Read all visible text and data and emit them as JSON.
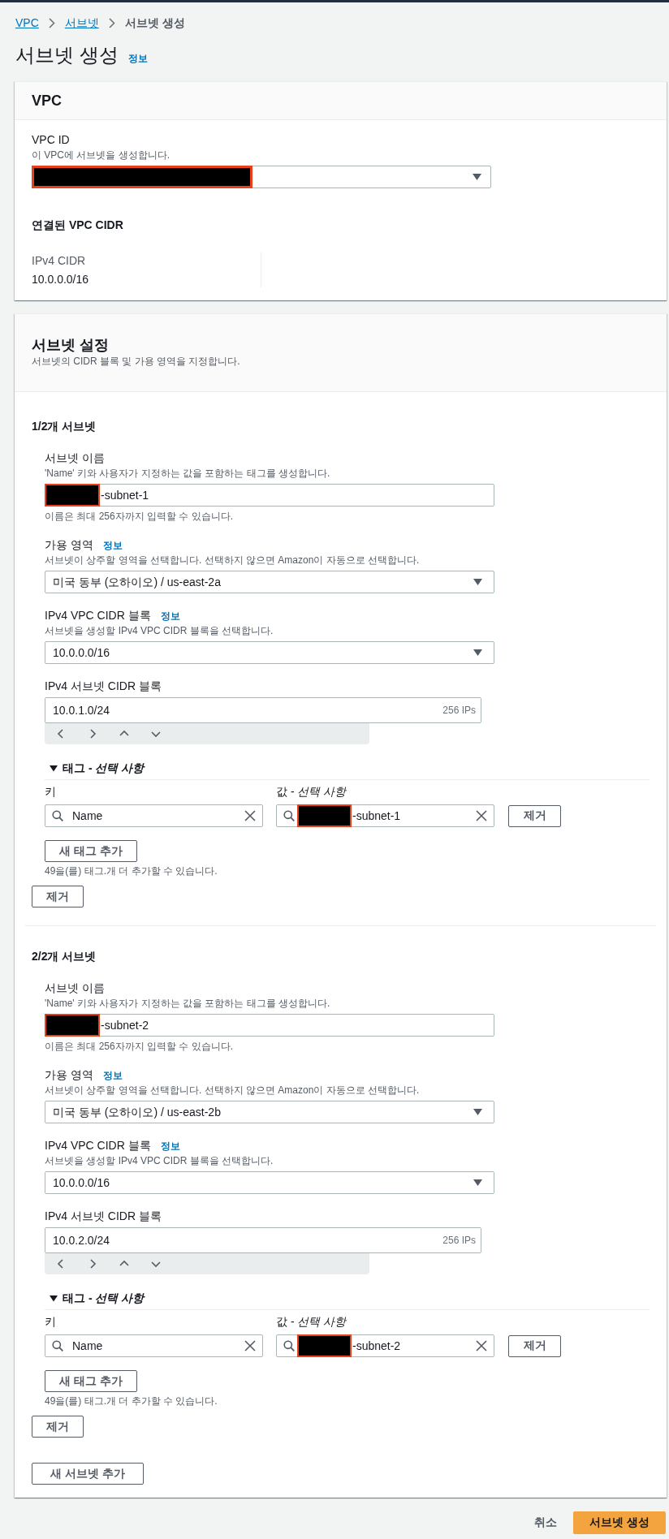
{
  "breadcrumbs": [
    {
      "label": "VPC",
      "current": false
    },
    {
      "label": "서브넷",
      "current": false
    },
    {
      "label": "서브넷 생성",
      "current": true
    }
  ],
  "header": {
    "title": "서브넷 생성",
    "info_link": "정보"
  },
  "vpc_panel": {
    "title": "VPC",
    "vpc_id": {
      "label": "VPC ID",
      "description": "이 VPC에 서브넷을 생성합니다.",
      "redacted": true
    },
    "cidr_section": {
      "title": "연결된 VPC CIDR",
      "items": [
        {
          "label": "IPv4 CIDR",
          "value": "10.0.0.0/16"
        }
      ]
    }
  },
  "subnet_settings": {
    "title": "서브넷 설정",
    "description": "서브넷의 CIDR 블록 및 가용 영역을 지정합니다.",
    "subnets": [
      {
        "heading": "1/2개 서브넷",
        "fields": [
          {
            "kind": "text_input",
            "label": "서브넷 이름",
            "description": "'Name' 키와 사용자가 지정하는 값을 포함하는 태그를 생성합니다.",
            "value": "-subnet-1",
            "redacted": true,
            "constraint": "이름은 최대 256자까지 입력할 수 있습니다."
          },
          {
            "kind": "select",
            "label": "가용 영역",
            "info_link": "정보",
            "description": "서브넷이 상주할 영역을 선택합니다. 선택하지 않으면 Amazon이 자동으로 선택합니다.",
            "value": "미국 동부 (오하이오) / us-east-2a",
            "redacted": false
          },
          {
            "kind": "select",
            "label": "IPv4 VPC CIDR 블록",
            "info_link": "정보",
            "description": "서브넷을 생성할 IPv4 VPC CIDR 블록을 선택합니다.",
            "value": "10.0.0.0/16",
            "redacted": false
          },
          {
            "kind": "cidr_input",
            "label": "IPv4 서브넷 CIDR 블록",
            "value": "10.0.1.0/24",
            "suffix": "256 IPs",
            "redacted": false
          }
        ],
        "tags": {
          "title": "태그 - *선택 사항*",
          "expanded": true,
          "key_label": "키",
          "value_label": "값 - *선택 사항*",
          "items": [
            {
              "key": "Name",
              "value": "-subnet-1",
              "value_redacted": true,
              "remove_button": "제거"
            }
          ],
          "add_button": "새 태그 추가",
          "hint": "49을(를) 태그.개 더 추가할 수 있습니다."
        },
        "remove_button": "제거"
      },
      {
        "heading": "2/2개 서브넷",
        "fields": [
          {
            "kind": "text_input",
            "label": "서브넷 이름",
            "description": "'Name' 키와 사용자가 지정하는 값을 포함하는 태그를 생성합니다.",
            "value": "-subnet-2",
            "redacted": true,
            "constraint": "이름은 최대 256자까지 입력할 수 있습니다."
          },
          {
            "kind": "select",
            "label": "가용 영역",
            "info_link": "정보",
            "description": "서브넷이 상주할 영역을 선택합니다. 선택하지 않으면 Amazon이 자동으로 선택합니다.",
            "value": "미국 동부 (오하이오) / us-east-2b",
            "redacted": false
          },
          {
            "kind": "select",
            "label": "IPv4 VPC CIDR 블록",
            "info_link": "정보",
            "description": "서브넷을 생성할 IPv4 VPC CIDR 블록을 선택합니다.",
            "value": "10.0.0.0/16",
            "redacted": false
          },
          {
            "kind": "cidr_input",
            "label": "IPv4 서브넷 CIDR 블록",
            "value": "10.0.2.0/24",
            "suffix": "256 IPs",
            "redacted": false
          }
        ],
        "tags": {
          "title": "태그 - *선택 사항*",
          "expanded": true,
          "key_label": "키",
          "value_label": "값 - *선택 사항*",
          "items": [
            {
              "key": "Name",
              "value": "-subnet-2",
              "value_redacted": true,
              "remove_button": "제거"
            }
          ],
          "add_button": "새 태그 추가",
          "hint": "49을(를) 태그.개 더 추가할 수 있습니다."
        },
        "remove_button": "제거"
      }
    ],
    "add_subnet_button": "새 서브넷 추가"
  },
  "footer": {
    "cancel_button": "취소",
    "submit_button": "서브넷 생성"
  }
}
